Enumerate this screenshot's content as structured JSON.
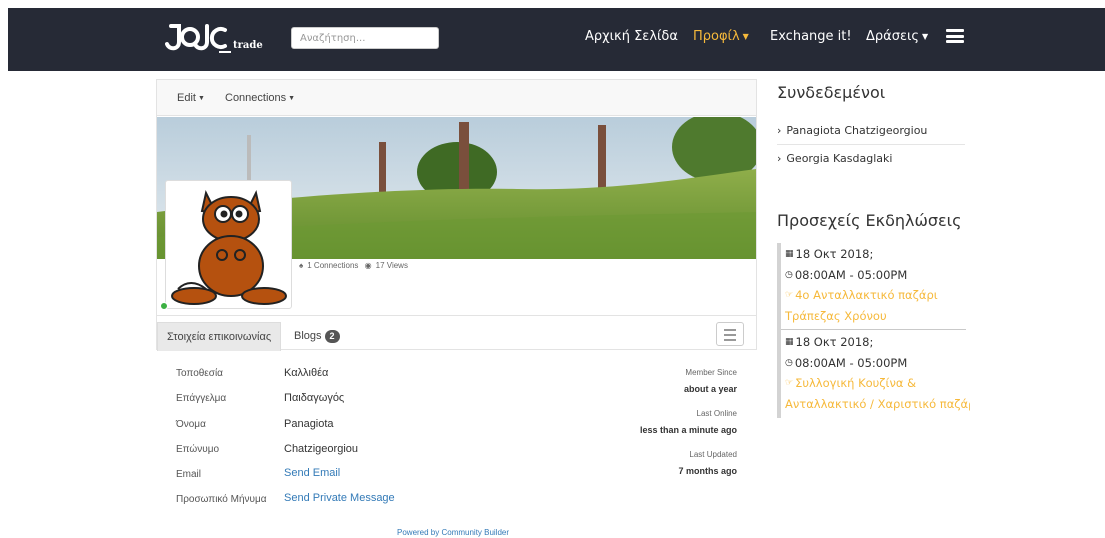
{
  "brand": {
    "logo_text": "trade",
    "accent_color": "#f6b93b",
    "navbar_color": "#262a36"
  },
  "search": {
    "placeholder": "Αναζήτηση..."
  },
  "nav": {
    "home": "Αρχική Σελίδα",
    "profile": "Προφίλ",
    "exchange": "Exchange it!",
    "actions": "Δράσεις"
  },
  "toolbar": {
    "edit": "Edit",
    "connections": "Connections"
  },
  "stats": {
    "connections": "1 Connections",
    "views": "17 Views"
  },
  "tabs": {
    "contact": "Στοιχεία επικοινωνίας",
    "blogs": "Blogs",
    "blogs_count": "2"
  },
  "fields": [
    {
      "label": "Τοποθεσία",
      "value": "Καλλιθέα"
    },
    {
      "label": "Επάγγελμα",
      "value": "Παιδαγωγός"
    },
    {
      "label": "Όνομα",
      "value": "Panagiota"
    },
    {
      "label": "Επώνυμο",
      "value": "Chatzigeorgiou"
    },
    {
      "label": "Email",
      "value": "Send Email"
    },
    {
      "label": "Προσωπικό Μήνυμα",
      "value": "Send Private Message"
    }
  ],
  "meta": {
    "member_since_label": "Member Since",
    "member_since": "about a year",
    "last_online_label": "Last Online",
    "last_online": "less than a minute ago",
    "last_updated_label": "Last Updated",
    "last_updated": "7 months ago"
  },
  "footer": {
    "powered": "Powered by Community Builder"
  },
  "sidebar": {
    "online_title": "Συνδεδεμένοι",
    "online_users": [
      "Panagiota Chatzigeorgiou",
      "Georgia Kasdaglaki"
    ],
    "events_title": "Προσεχείς Εκδηλώσεις",
    "events": [
      {
        "date": "18 Οκτ 2018;",
        "time": "08:00AM - 05:00PM",
        "title_1": "4ο Ανταλλακτικό παζάρι",
        "title_2": "Τράπεζας Χρόνου"
      },
      {
        "date": "18 Οκτ 2018;",
        "time": "08:00AM - 05:00PM",
        "title_1": "Συλλογική Κουζίνα &",
        "title_2": "Ανταλλακτικό / Χαριστικό παζάρι"
      }
    ]
  }
}
